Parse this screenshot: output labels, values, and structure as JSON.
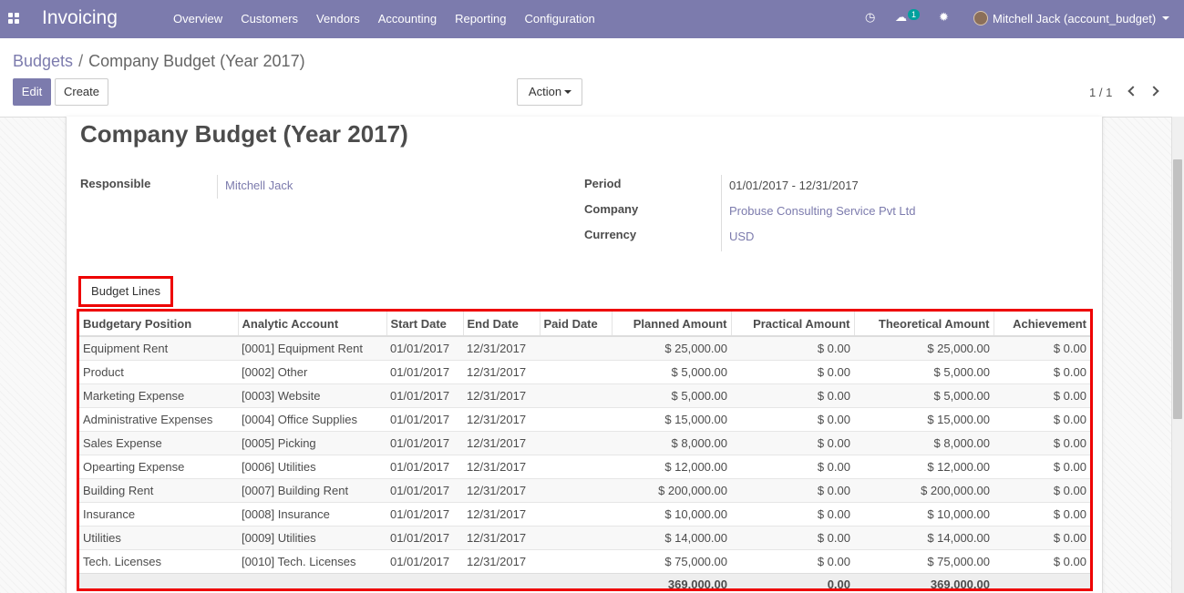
{
  "navbar": {
    "brand": "Invoicing",
    "menu": [
      "Overview",
      "Customers",
      "Vendors",
      "Accounting",
      "Reporting",
      "Configuration"
    ],
    "messages_count": "1",
    "user": "Mitchell Jack (account_budget)",
    "color": "#7c7bad"
  },
  "breadcrumb": {
    "parent": "Budgets",
    "separator": "/",
    "current": "Company Budget (Year 2017)"
  },
  "buttons": {
    "edit": "Edit",
    "create": "Create",
    "action": "Action"
  },
  "pager": "1 / 1",
  "form": {
    "title": "Company Budget (Year 2017)",
    "responsible_label": "Responsible",
    "responsible": "Mitchell Jack",
    "period_label": "Period",
    "period": "01/01/2017 - 12/31/2017",
    "company_label": "Company",
    "company": "Probuse Consulting Service Pvt Ltd",
    "currency_label": "Currency",
    "currency": "USD"
  },
  "tab": "Budget Lines",
  "table": {
    "headers": [
      "Budgetary Position",
      "Analytic Account",
      "Start Date",
      "End Date",
      "Paid Date",
      "Planned Amount",
      "Practical Amount",
      "Theoretical Amount",
      "Achievement"
    ],
    "rows": [
      [
        "Equipment Rent",
        "[0001] Equipment Rent",
        "01/01/2017",
        "12/31/2017",
        "",
        "$ 25,000.00",
        "$ 0.00",
        "$ 25,000.00",
        "$ 0.00"
      ],
      [
        "Product",
        "[0002] Other",
        "01/01/2017",
        "12/31/2017",
        "",
        "$ 5,000.00",
        "$ 0.00",
        "$ 5,000.00",
        "$ 0.00"
      ],
      [
        "Marketing Expense",
        "[0003] Website",
        "01/01/2017",
        "12/31/2017",
        "",
        "$ 5,000.00",
        "$ 0.00",
        "$ 5,000.00",
        "$ 0.00"
      ],
      [
        "Administrative Expenses",
        "[0004] Office Supplies",
        "01/01/2017",
        "12/31/2017",
        "",
        "$ 15,000.00",
        "$ 0.00",
        "$ 15,000.00",
        "$ 0.00"
      ],
      [
        "Sales Expense",
        "[0005] Picking",
        "01/01/2017",
        "12/31/2017",
        "",
        "$ 8,000.00",
        "$ 0.00",
        "$ 8,000.00",
        "$ 0.00"
      ],
      [
        "Opearting Expense",
        "[0006] Utilities",
        "01/01/2017",
        "12/31/2017",
        "",
        "$ 12,000.00",
        "$ 0.00",
        "$ 12,000.00",
        "$ 0.00"
      ],
      [
        "Building Rent",
        "[0007] Building Rent",
        "01/01/2017",
        "12/31/2017",
        "",
        "$ 200,000.00",
        "$ 0.00",
        "$ 200,000.00",
        "$ 0.00"
      ],
      [
        "Insurance",
        "[0008] Insurance",
        "01/01/2017",
        "12/31/2017",
        "",
        "$ 10,000.00",
        "$ 0.00",
        "$ 10,000.00",
        "$ 0.00"
      ],
      [
        "Utilities",
        "[0009] Utilities",
        "01/01/2017",
        "12/31/2017",
        "",
        "$ 14,000.00",
        "$ 0.00",
        "$ 14,000.00",
        "$ 0.00"
      ],
      [
        "Tech. Licenses",
        "[0010] Tech. Licenses",
        "01/01/2017",
        "12/31/2017",
        "",
        "$ 75,000.00",
        "$ 0.00",
        "$ 75,000.00",
        "$ 0.00"
      ]
    ],
    "totals": {
      "planned": "369,000.00",
      "practical": "0.00",
      "theoretical": "369,000.00"
    }
  }
}
